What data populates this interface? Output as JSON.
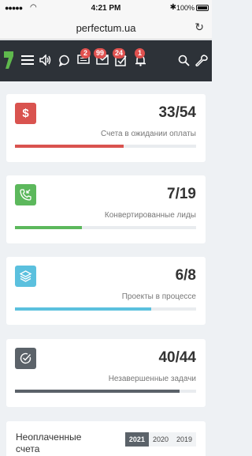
{
  "status": {
    "time": "4:21 PM",
    "battery": "100%"
  },
  "browser": {
    "url": "perfectum.ua"
  },
  "header": {
    "badges": {
      "chat": "2",
      "mail": "99",
      "tasks": "24",
      "bell": "1"
    }
  },
  "cards": [
    {
      "value": "33/54",
      "label": "Счета в ожидании оплаты",
      "progress": 0.6,
      "color": "#d9534f",
      "icon": "dollar-icon"
    },
    {
      "value": "7/19",
      "label": "Конвертированные лиды",
      "progress": 0.37,
      "color": "#5cb85c",
      "icon": "phone-incoming-icon"
    },
    {
      "value": "6/8",
      "label": "Проекты в процессе",
      "progress": 0.75,
      "color": "#5bc0de",
      "icon": "layers-icon"
    },
    {
      "value": "40/44",
      "label": "Незавершенные задачи",
      "progress": 0.91,
      "color": "#5b6269",
      "icon": "check-circle-icon"
    }
  ],
  "unpaid": {
    "title": "Неоплаченные счета",
    "years": [
      "2021",
      "2020",
      "2019"
    ],
    "active_year": "2021"
  }
}
